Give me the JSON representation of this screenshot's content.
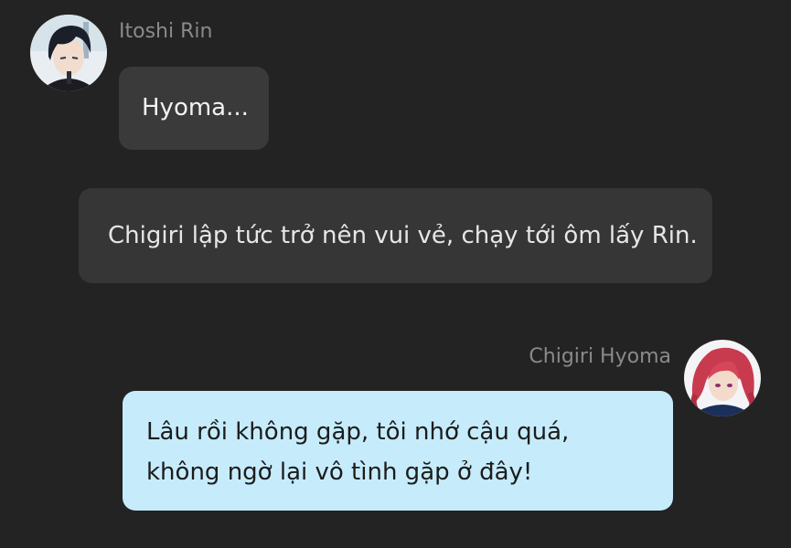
{
  "messages": [
    {
      "sender": "Itoshi Rin",
      "avatar_icon": "rin-avatar-icon",
      "text": "Hyoma..."
    },
    {
      "type": "narration",
      "text": "Chigiri lập tức trở nên vui vẻ, chạy tới ôm lấy Rin."
    },
    {
      "sender": "Chigiri Hyoma",
      "avatar_icon": "chigiri-avatar-icon",
      "text": "Lâu rồi không gặp, tôi nhớ cậu quá, không ngờ lại vô tình gặp ở đây!"
    }
  ],
  "colors": {
    "background": "#232323",
    "received_bubble": "#3a3a3a",
    "narration_bubble": "#363636",
    "sent_bubble": "#c6ecfc",
    "sender_name": "#8a8a8a"
  }
}
